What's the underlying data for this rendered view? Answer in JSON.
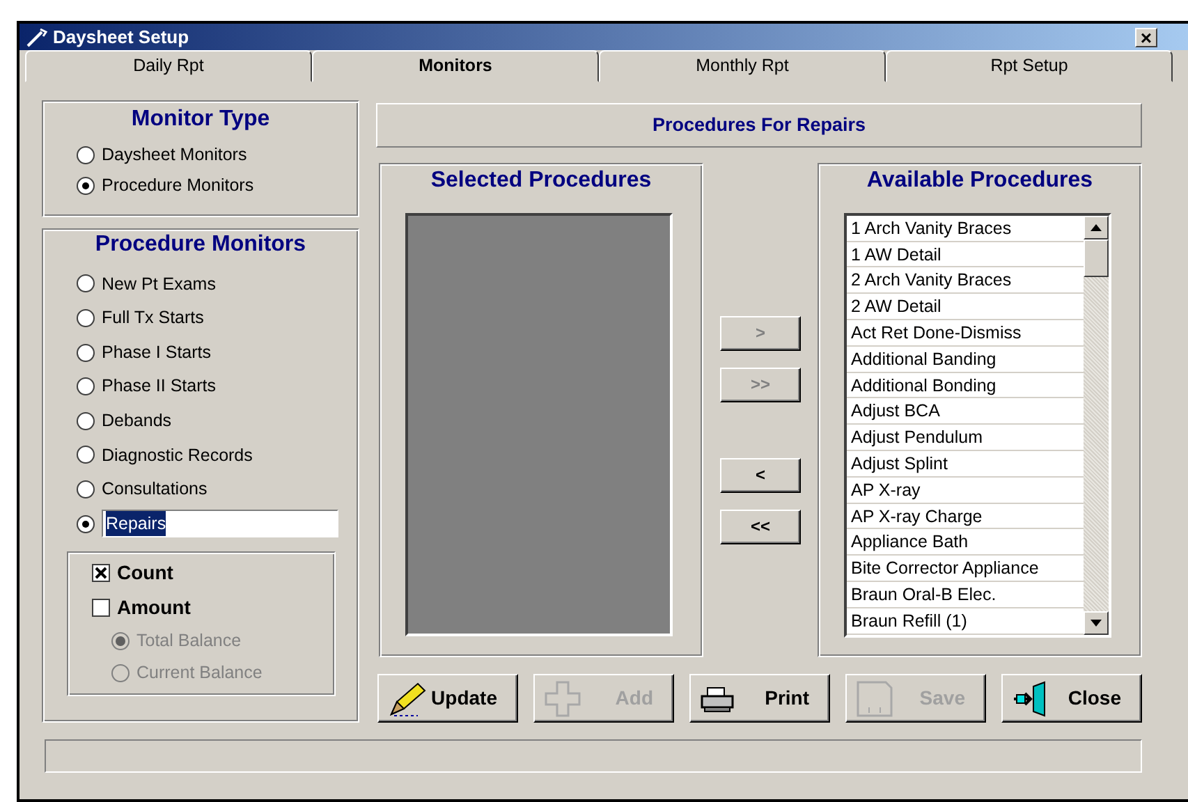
{
  "window": {
    "title": "Daysheet Setup",
    "close_label": "×"
  },
  "tabs": [
    {
      "label": "Daily Rpt",
      "selected": false
    },
    {
      "label": "Monitors",
      "selected": true
    },
    {
      "label": "Monthly Rpt",
      "selected": false
    },
    {
      "label": "Rpt Setup",
      "selected": false
    }
  ],
  "monitor_type": {
    "title": "Monitor Type",
    "options": [
      {
        "label": "Daysheet Monitors",
        "selected": false
      },
      {
        "label": "Procedure Monitors",
        "selected": true
      }
    ]
  },
  "procedure_monitors": {
    "title": "Procedure Monitors",
    "options": [
      {
        "kind": "radio",
        "label": "New Pt Exams",
        "selected": false
      },
      {
        "kind": "radio",
        "label": "Full Tx Starts",
        "selected": false
      },
      {
        "kind": "radio",
        "label": "Phase I Starts",
        "selected": false
      },
      {
        "kind": "radio",
        "label": "Phase II Starts",
        "selected": false
      },
      {
        "kind": "radio",
        "label": "Debands",
        "selected": false
      },
      {
        "kind": "radio",
        "label": "Diagnostic Records",
        "selected": false
      },
      {
        "kind": "radio",
        "label": "Consultations",
        "selected": false
      },
      {
        "kind": "field",
        "value": "Repairs",
        "selected": true
      }
    ],
    "measures": [
      {
        "label": "Count",
        "checked": true
      },
      {
        "label": "Amount",
        "checked": false
      }
    ],
    "balances": [
      {
        "label": "Total Balance",
        "selected": true,
        "disabled": true
      },
      {
        "label": "Current Balance",
        "selected": false,
        "disabled": true
      }
    ]
  },
  "header": "Procedures For Repairs",
  "selected_procedures": {
    "title": "Selected Procedures",
    "disabled": true
  },
  "transfer_buttons": [
    {
      "label": ">",
      "disabled": true
    },
    {
      "label": ">>",
      "disabled": true
    },
    {
      "label": "<",
      "disabled": false
    },
    {
      "label": "<<",
      "disabled": false
    }
  ],
  "available_procedures": {
    "title": "Available Procedures",
    "items": [
      "1 Arch Vanity Braces",
      "1 AW Detail",
      "2 Arch Vanity Braces",
      "2 AW Detail",
      "Act Ret Done-Dismiss",
      "Additional Banding",
      "Additional Bonding",
      "Adjust BCA",
      "Adjust Pendulum",
      "Adjust Splint",
      "AP X-ray",
      "AP X-ray Charge",
      "Appliance Bath",
      "Bite Corrector Appliance",
      "Braun Oral-B Elec.",
      "Braun Refill (1)"
    ]
  },
  "action_buttons": [
    {
      "kind": "pencil",
      "label": "Update",
      "disabled": false
    },
    {
      "kind": "plus",
      "label": "Add",
      "disabled": true
    },
    {
      "kind": "printer",
      "label": "Print",
      "disabled": false
    },
    {
      "kind": "floppy",
      "label": "Save",
      "disabled": true
    },
    {
      "kind": "door",
      "label": "Close",
      "disabled": false
    }
  ]
}
